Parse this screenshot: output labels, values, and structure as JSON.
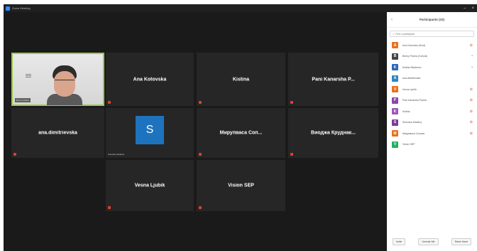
{
  "window": {
    "title": "Zoom Meeting",
    "minimize_glyph": "–",
    "close_glyph": "×"
  },
  "grid": {
    "tiles": [
      {
        "id": "self-video",
        "name": "",
        "video": true,
        "chip": "Benny Pasha"
      },
      {
        "id": "t2",
        "name": "Ana Kotovska"
      },
      {
        "id": "t3",
        "name": "Kistina"
      },
      {
        "id": "t4",
        "name": "Pani Kanarsha P..."
      },
      {
        "id": "t5",
        "name": "ana.dimitrievska"
      },
      {
        "id": "t6",
        "name": "",
        "avatar_letter": "S",
        "caption": "Snezana Madincj"
      },
      {
        "id": "t7",
        "name": "Мирупваса Соп..."
      },
      {
        "id": "t8",
        "name": "Виоджа Круднак..."
      },
      {
        "id": "t9",
        "name": "Vesna Ljubik"
      },
      {
        "id": "t10",
        "name": "Vision SEP"
      }
    ],
    "colors": {
      "active_border": "#9ac94a",
      "tile_bg": "#262626",
      "mute": "#e0402a",
      "avatar": "#1e73be"
    }
  },
  "panel": {
    "title": "Participants (10)",
    "back_glyph": "‹",
    "search_placeholder": "Find a participant",
    "participants": [
      {
        "name": "Ana Kotovska (Host)",
        "initial": "A",
        "color": "#e8711f",
        "mic": "muted"
      },
      {
        "name": "Benny Pasha (Cohost)",
        "initial": "B",
        "color": "#444444",
        "mic": "on"
      },
      {
        "name": "Kistina Mladenov",
        "initial": "K",
        "color": "#2e66b8",
        "mic": "on"
      },
      {
        "name": "ana.dimitrievska",
        "initial": "A",
        "color": "#2e86c1",
        "mic": "none"
      },
      {
        "name": "Vesna Ljubik",
        "initial": "V",
        "color": "#e8711f",
        "mic": "muted"
      },
      {
        "name": "Pani Kanarsha Pasha",
        "initial": "P",
        "color": "#8e44ad",
        "mic": "muted"
      },
      {
        "name": "Kistina",
        "initial": "K",
        "color": "#9b59b6",
        "mic": "muted"
      },
      {
        "name": "Snezana Madincj",
        "initial": "S",
        "color": "#7d3c98",
        "mic": "muted"
      },
      {
        "name": "Мирупваса Сопова",
        "initial": "M",
        "color": "#e8711f",
        "mic": "muted"
      },
      {
        "name": "Vision SEP",
        "initial": "V",
        "color": "#27ae60",
        "mic": "none"
      }
    ],
    "footer": {
      "invite": "Invite",
      "mute_all": "Unmute Me",
      "more": "Raise Hand"
    }
  }
}
